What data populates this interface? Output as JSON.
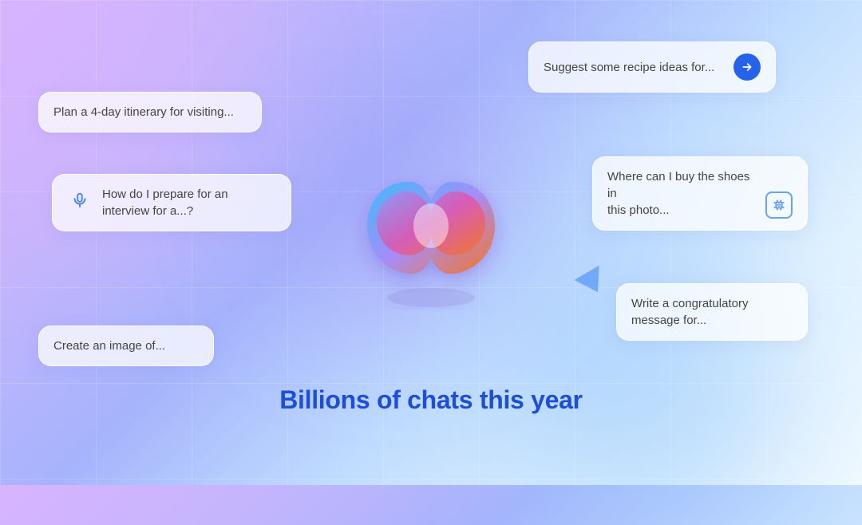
{
  "background": {
    "color_start": "#d8b4fe",
    "color_end": "#e0f2fe"
  },
  "headline": "Billions of chats this year",
  "cards": {
    "plan": {
      "text": "Plan a 4-day itinerary for visiting..."
    },
    "interview": {
      "text_line1": "How do I prepare for an",
      "text_line2": "interview for a...?"
    },
    "create": {
      "text": "Create an image of..."
    },
    "suggest": {
      "text": "Suggest some recipe ideas for...",
      "send_icon": "send-icon"
    },
    "shoes": {
      "text_line1": "Where can I buy the shoes in",
      "text_line2": "this photo...",
      "camera_icon": "camera-icon"
    },
    "congrats": {
      "text_line1": "Write a congratulatory",
      "text_line2": "message for..."
    }
  },
  "icons": {
    "mic": "microphone",
    "send": "send-arrow",
    "camera": "camera-scan",
    "arrow_deco": "arrow-pointer"
  }
}
